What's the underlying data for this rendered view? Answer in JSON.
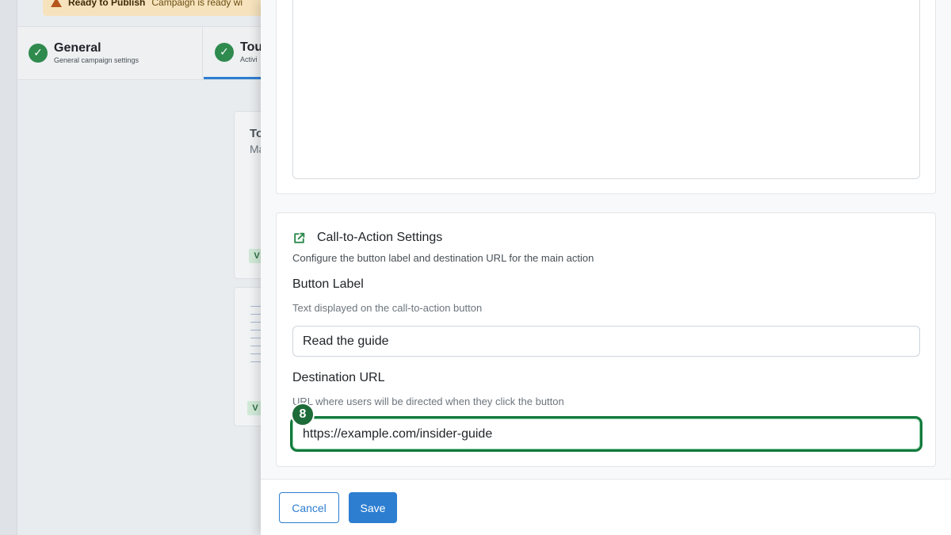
{
  "background": {
    "alert": {
      "title": "Ready to Publish",
      "text": "Campaign is ready wi"
    },
    "steps": [
      {
        "title": "General",
        "subtitle": "General campaign settings"
      },
      {
        "title": "Tou",
        "subtitle": "Activi"
      }
    ],
    "card_fragments": {
      "title": "To",
      "subtitle": "Ma",
      "badge_1": "V",
      "badge_2": "V"
    }
  },
  "drawer": {
    "cta_section": {
      "icon": "external-link-icon",
      "title": "Call-to-Action Settings",
      "description": "Configure the button label and destination URL for the main action"
    },
    "button_label": {
      "label": "Button Label",
      "help": "Text displayed on the call-to-action button",
      "value": "Read the guide"
    },
    "destination_url": {
      "label": "Destination URL",
      "help": "URL where users will be directed when they click the button",
      "value": "https://example.com/insider-guide"
    },
    "step_marker": "8",
    "footer": {
      "cancel_label": "Cancel",
      "save_label": "Save"
    }
  },
  "colors": {
    "accent": "#2d7ed1",
    "success": "#2f8a4e",
    "focus_ring": "#137a3d"
  }
}
